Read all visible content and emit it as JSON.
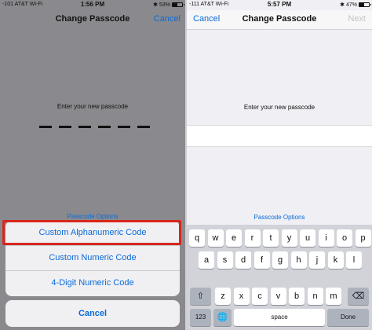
{
  "left_screen": {
    "status": {
      "carrier": "-101 AT&T Wi-Fi",
      "time": "1:56 PM",
      "battery": "53%",
      "battery_level": 0.53
    },
    "nav": {
      "title": "Change Passcode",
      "right_button": "Cancel"
    },
    "prompt": "Enter your new passcode",
    "options_link": "Passcode Options",
    "action_sheet": {
      "items": [
        {
          "label": "Custom Alphanumeric Code",
          "highlighted": true
        },
        {
          "label": "Custom Numeric Code"
        },
        {
          "label": "4-Digit Numeric Code"
        }
      ],
      "cancel": "Cancel"
    }
  },
  "right_screen": {
    "status": {
      "carrier": "-111 AT&T Wi-Fi",
      "time": "5:57 PM",
      "battery": "47%",
      "battery_level": 0.47
    },
    "nav": {
      "left_button": "Cancel",
      "title": "Change Passcode",
      "right_button": "Next"
    },
    "prompt": "Enter your new passcode",
    "options_link": "Passcode Options",
    "keyboard": {
      "row1": [
        "q",
        "w",
        "e",
        "r",
        "t",
        "y",
        "u",
        "i",
        "o",
        "p"
      ],
      "row2": [
        "a",
        "s",
        "d",
        "f",
        "g",
        "h",
        "j",
        "k",
        "l"
      ],
      "row3": [
        "z",
        "x",
        "c",
        "v",
        "b",
        "n",
        "m"
      ],
      "shift": "⇧",
      "backspace": "⌫",
      "numbers": "123",
      "globe": "🌐",
      "space": "space",
      "done": "Done"
    }
  },
  "colors": {
    "accent": "#0a6ad8",
    "highlight": "#d8261d"
  }
}
